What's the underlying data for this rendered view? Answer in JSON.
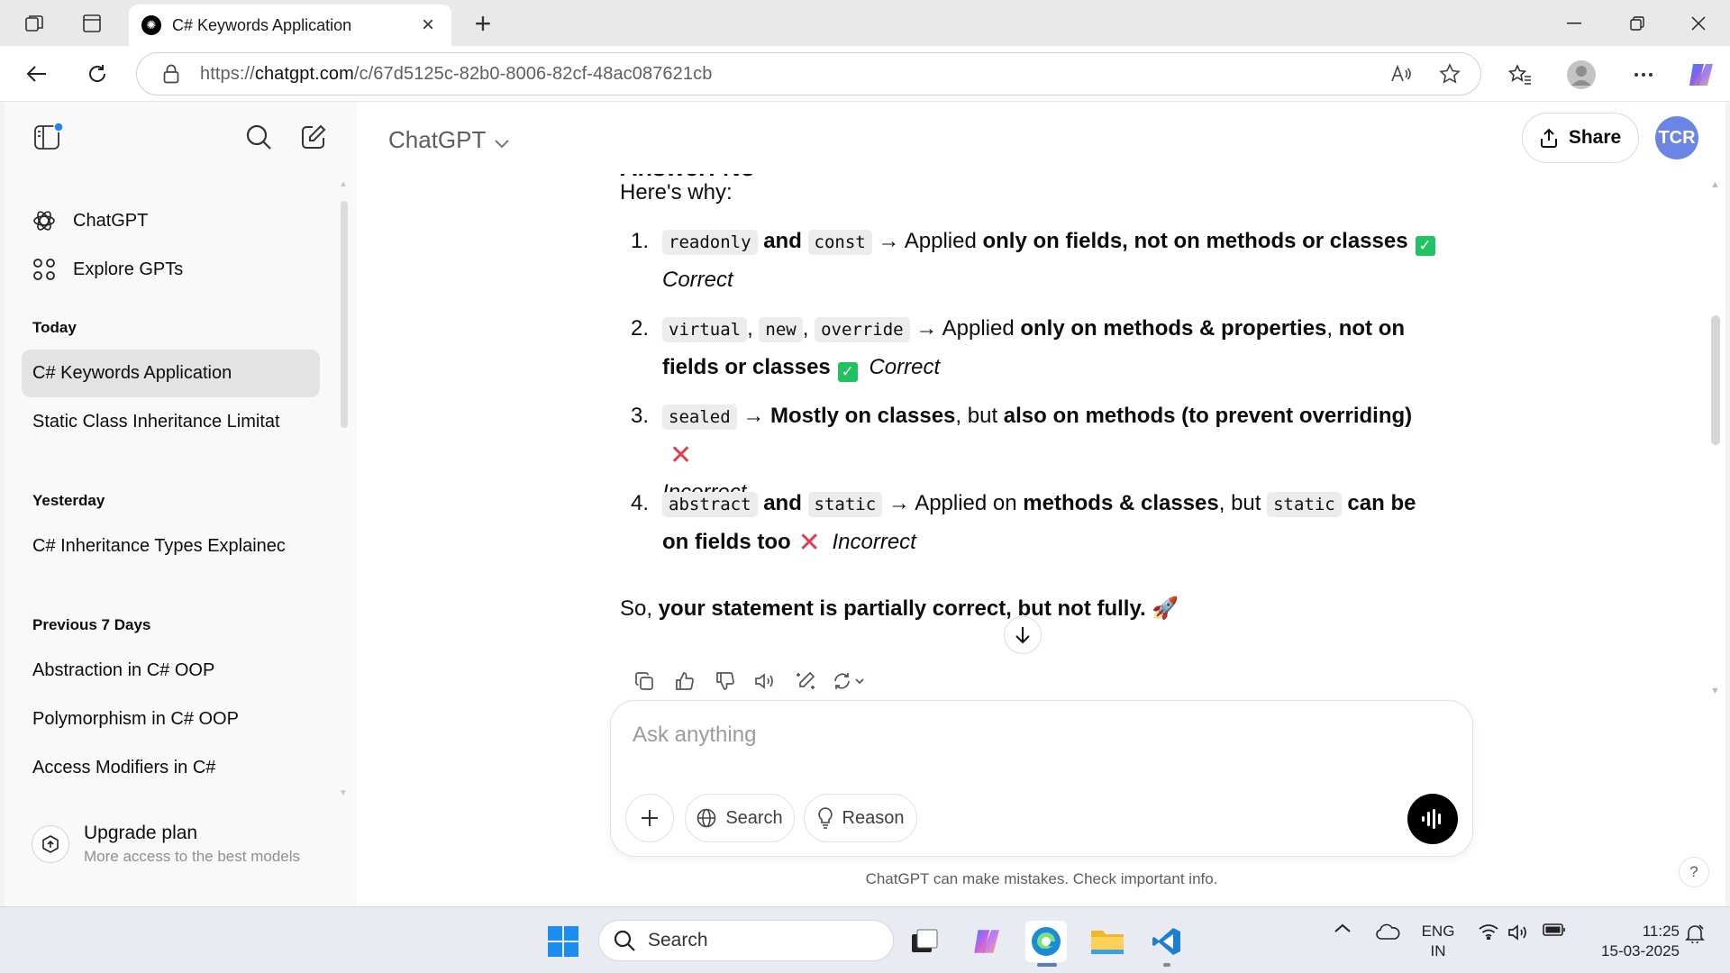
{
  "browser": {
    "tab_title": "C# Keywords Application",
    "url_prefix": "https://",
    "url_domain": "chatgpt.com",
    "url_path": "/c/67d5125c-82b0-8006-82cf-48ac087621cb"
  },
  "sidebar": {
    "nav": [
      {
        "label": "ChatGPT",
        "icon": "chatgpt-logo-icon"
      },
      {
        "label": "Explore GPTs",
        "icon": "grid-icon"
      }
    ],
    "sections": [
      {
        "heading": "Today",
        "items": [
          "C# Keywords Application",
          "Static Class Inheritance Limitat"
        ]
      },
      {
        "heading": "Yesterday",
        "items": [
          "C# Inheritance Types Explainec"
        ]
      },
      {
        "heading": "Previous 7 Days",
        "items": [
          "Abstraction in C# OOP",
          "Polymorphism in C# OOP",
          "Access Modifiers in C#"
        ]
      }
    ],
    "upgrade": {
      "title": "Upgrade plan",
      "subtitle": "More access to the best models"
    }
  },
  "main": {
    "model_title": "ChatGPT",
    "share_label": "Share",
    "avatar_initials": "TCR",
    "cutoff_heading": "Answer: No",
    "intro": "Here's why:",
    "list": [
      {
        "num": "1.",
        "code1": "readonly",
        "t1": "and",
        "code2": "const",
        "arrow": "→ Applied",
        "bold": "only on fields, not on methods or classes",
        "verdict": "Correct",
        "verdict_icon": "check-icon"
      },
      {
        "num": "2.",
        "code1": "virtual",
        "code2": "new",
        "code3": "override",
        "arrow": "→ Applied",
        "bold1": "only on methods & properties",
        "bold2": "not on fields or classes",
        "verdict": "Correct",
        "verdict_icon": "check-icon"
      },
      {
        "num": "3.",
        "code1": "sealed",
        "bold1": "→ Mostly on classes",
        "plain": ", but",
        "bold2": "also on methods (to prevent overriding)",
        "verdict": "Incorrect",
        "verdict_icon": "cross-icon"
      },
      {
        "num": "4.",
        "code1": "abstract",
        "t1": "and",
        "code2": "static",
        "arrow": "→ Applied on",
        "bold1": "methods & classes",
        "plain": ", but",
        "code3": "static",
        "bold2": "can be on fields too",
        "verdict": "Incorrect",
        "verdict_icon": "cross-icon"
      }
    ],
    "summary_plain": "So,",
    "summary_bold": "your statement is partially correct, but not fully.",
    "summary_emoji": "🚀",
    "composer_placeholder": "Ask anything",
    "search_label": "Search",
    "reason_label": "Reason",
    "disclaimer": "ChatGPT can make mistakes. Check important info.",
    "help_label": "?"
  },
  "taskbar": {
    "search_label": "Search",
    "lang_top": "ENG",
    "lang_bottom": "IN",
    "time": "11:25",
    "date": "15-03-2025"
  },
  "colors": {
    "accent_avatar": "#6a85e6",
    "check_green": "#21c261",
    "cross_red": "#e43a4f"
  }
}
